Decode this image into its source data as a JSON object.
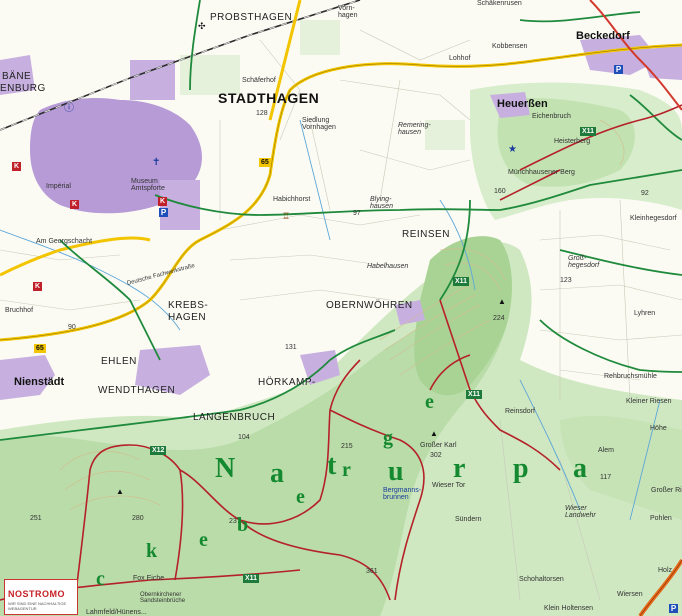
{
  "map": {
    "towns": [
      {
        "id": "stadthagen",
        "name": "STADTHAGEN"
      },
      {
        "id": "nienstaedt",
        "name": "Nienstädt"
      },
      {
        "id": "beckedorf",
        "name": "Beckedorf"
      },
      {
        "id": "heuerssen",
        "name": "Heuerßen"
      }
    ],
    "villages": [
      {
        "id": "probsthagen",
        "name": "PROBSTHAGEN"
      },
      {
        "id": "reinsen",
        "name": "REINSEN"
      },
      {
        "id": "obernwoehren",
        "name": "OBERNWÖHREN"
      },
      {
        "id": "krebshagen",
        "name": "KREBS-\nHAGEN"
      },
      {
        "id": "ehlen",
        "name": "EHLEN"
      },
      {
        "id": "wendthagen",
        "name": "WENDTHAGEN"
      },
      {
        "id": "hoerkamp",
        "name": "HÖRKAMP-"
      },
      {
        "id": "langenbruch",
        "name": "LANGENBRUCH"
      },
      {
        "id": "baene",
        "name": "BÄNE"
      },
      {
        "id": "enburg",
        "name": "ENBURG"
      }
    ],
    "places": [
      {
        "id": "vornhagen",
        "name": "Vorn-\nhagen"
      },
      {
        "id": "schaeferhof",
        "name": "Schäferhof"
      },
      {
        "id": "siedlung",
        "name": "Siedlung\nVornhagen"
      },
      {
        "id": "habichhorst",
        "name": "Habichhorst"
      },
      {
        "id": "remeringhausen",
        "name": "Remering-\nhausen"
      },
      {
        "id": "blyinghausen",
        "name": "Blying-\nhausen"
      },
      {
        "id": "habelhausen",
        "name": "Habelhausen"
      },
      {
        "id": "kobbensen",
        "name": "Kobbensen"
      },
      {
        "id": "lohhof",
        "name": "Lohhof"
      },
      {
        "id": "eichenbruch",
        "name": "Eichenbruch"
      },
      {
        "id": "heisterberg",
        "name": "Heisterberg"
      },
      {
        "id": "muenchhausener",
        "name": "Münchhausener Berg"
      },
      {
        "id": "kleinhegesdorf",
        "name": "Kleinhegesdorf"
      },
      {
        "id": "grosshegesdorf",
        "name": "Groß-\nhegesdorf"
      },
      {
        "id": "lyhren",
        "name": "Lyhren"
      },
      {
        "id": "rehbruch",
        "name": "Rehbruchsmühle"
      },
      {
        "id": "kleinerriesen",
        "name": "Kleiner Riesen"
      },
      {
        "id": "reinsdorf",
        "name": "Reinsdorf"
      },
      {
        "id": "grosserkarl",
        "name": "Großer Karl"
      },
      {
        "id": "wiesertor",
        "name": "Wieser Tor"
      },
      {
        "id": "wieserlandwehr",
        "name": "Wieser\nLandwehr"
      },
      {
        "id": "hoehe",
        "name": "Höhe"
      },
      {
        "id": "alem",
        "name": "Alem"
      },
      {
        "id": "grosserriesen",
        "name": "Großer Ri"
      },
      {
        "id": "pohlen",
        "name": "Pohlen"
      },
      {
        "id": "suendern",
        "name": "Sündern"
      },
      {
        "id": "schohalftorsen",
        "name": "Schohaltorsen"
      },
      {
        "id": "kleinhoftorsen",
        "name": "Klein Holtensen"
      },
      {
        "id": "wiersen",
        "name": "Wiersen"
      },
      {
        "id": "holz",
        "name": "Holz"
      },
      {
        "id": "bruchhof",
        "name": "Bruchhof"
      },
      {
        "id": "amgeorgschacht",
        "name": "Am Georgschacht"
      },
      {
        "id": "imperial",
        "name": "Impérial"
      },
      {
        "id": "museum",
        "name": "Museum\nAmtspforte"
      },
      {
        "id": "foxeiche",
        "name": "Fox Eiche"
      },
      {
        "id": "obernkirchener",
        "name": "Obernkirchener\nSandsteinbrüche"
      },
      {
        "id": "lahmfeld",
        "name": "Lahmfeld/Hünens..."
      },
      {
        "id": "schaekenrusen",
        "name": "Schäkenrusen"
      },
      {
        "id": "deutsche",
        "name": "Deutsche Fachwerkstraße"
      },
      {
        "id": "bergmannsb",
        "name": "Bergmanns-\nbrunnen"
      }
    ],
    "spot_heights": [
      {
        "id": "h128",
        "value": "128"
      },
      {
        "id": "h160",
        "value": "160"
      },
      {
        "id": "h224",
        "value": "224"
      },
      {
        "id": "h123",
        "value": "123"
      },
      {
        "id": "h131",
        "value": "131"
      },
      {
        "id": "h302",
        "value": "302"
      },
      {
        "id": "h215",
        "value": "215"
      },
      {
        "id": "h280",
        "value": "280"
      },
      {
        "id": "h251",
        "value": "251"
      },
      {
        "id": "h237",
        "value": "237"
      },
      {
        "id": "h361",
        "value": "361"
      },
      {
        "id": "h90",
        "value": "90"
      },
      {
        "id": "h97",
        "value": "97"
      },
      {
        "id": "h92",
        "value": "92"
      },
      {
        "id": "h117",
        "value": "117"
      },
      {
        "id": "h104",
        "value": "104"
      }
    ],
    "road_numbers": [
      {
        "id": "r65a",
        "value": "65",
        "style": "y"
      },
      {
        "id": "r65b",
        "value": "65",
        "style": "y"
      },
      {
        "id": "x11a",
        "value": "X11",
        "style": "g"
      },
      {
        "id": "x11b",
        "value": "X11",
        "style": "g"
      },
      {
        "id": "x11c",
        "value": "X11",
        "style": "g"
      },
      {
        "id": "x11d",
        "value": "X11",
        "style": "g"
      },
      {
        "id": "x12",
        "value": "X12",
        "style": "g"
      },
      {
        "id": "k1",
        "value": "K",
        "style": "k"
      },
      {
        "id": "k2",
        "value": "K",
        "style": "k"
      },
      {
        "id": "k3",
        "value": "K",
        "style": "k"
      },
      {
        "id": "k4",
        "value": "K",
        "style": "k"
      }
    ],
    "park_letters": [
      "N",
      "a",
      "t",
      "u",
      "r",
      "p",
      "a"
    ],
    "park_letters_small": [
      "c",
      "k",
      "e",
      "b",
      "e",
      "r",
      "g",
      "e"
    ],
    "logo": {
      "title": "NOSTROMO",
      "subtitle": "WIR SIND EINE NACHHALTIGE WEBAGENTUR"
    },
    "colors": {
      "forest": "#cfe8c1",
      "forest_dark": "#b9dca9",
      "urban": "#b79bd6",
      "road_green": "#1f8a3c",
      "trail_red": "#b52129",
      "road_yellow": "#f2c500",
      "park_text": "#14892f",
      "railway": "#2b2b2b"
    },
    "icons": [
      {
        "id": "parking-1",
        "name": "parking-icon"
      },
      {
        "id": "parking-2",
        "name": "parking-icon"
      },
      {
        "id": "parking-3",
        "name": "parking-icon"
      },
      {
        "id": "info-1",
        "name": "information-icon"
      },
      {
        "id": "viewpoint-1",
        "name": "viewpoint-icon"
      },
      {
        "id": "church-1",
        "name": "church-icon"
      }
    ]
  }
}
